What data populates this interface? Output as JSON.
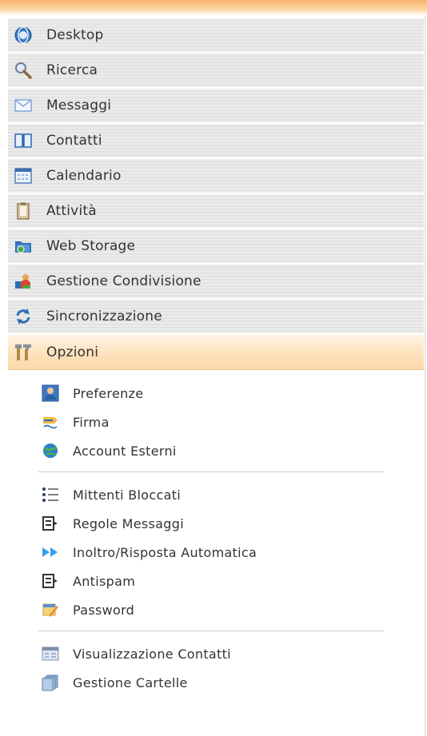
{
  "nav": {
    "items": [
      {
        "label": "Desktop",
        "icon": "desktop-globe-icon"
      },
      {
        "label": "Ricerca",
        "icon": "search-magnifier-icon"
      },
      {
        "label": "Messaggi",
        "icon": "envelope-icon"
      },
      {
        "label": "Contatti",
        "icon": "address-book-icon"
      },
      {
        "label": "Calendario",
        "icon": "calendar-icon"
      },
      {
        "label": "Attività",
        "icon": "task-clipboard-icon"
      },
      {
        "label": "Web Storage",
        "icon": "web-storage-folder-icon"
      },
      {
        "label": "Gestione Condivisione",
        "icon": "sharing-people-icon"
      },
      {
        "label": "Sincronizzazione",
        "icon": "sync-arrows-icon"
      },
      {
        "label": "Opzioni",
        "icon": "tools-icon",
        "active": true
      }
    ]
  },
  "options": {
    "group1": [
      {
        "label": "Preferenze",
        "icon": "user-card-icon"
      },
      {
        "label": "Firma",
        "icon": "pen-signature-icon"
      },
      {
        "label": "Account Esterni",
        "icon": "external-accounts-globe-icon"
      }
    ],
    "group2": [
      {
        "label": "Mittenti Bloccati",
        "icon": "blocked-list-icon"
      },
      {
        "label": "Regole Messaggi",
        "icon": "rules-icon"
      },
      {
        "label": "Inoltro/Risposta Automatica",
        "icon": "forward-arrows-icon"
      },
      {
        "label": "Antispam",
        "icon": "antispam-icon"
      },
      {
        "label": "Password",
        "icon": "password-key-icon"
      }
    ],
    "group3": [
      {
        "label": "Visualizzazione Contatti",
        "icon": "contacts-view-icon"
      },
      {
        "label": "Gestione Cartelle",
        "icon": "folders-icon"
      }
    ]
  },
  "colors": {
    "active_bg": "#fde3bf",
    "top_accent": "#f6b56c",
    "stripe_light": "#ececec",
    "stripe_dark": "#e2e2e2"
  }
}
